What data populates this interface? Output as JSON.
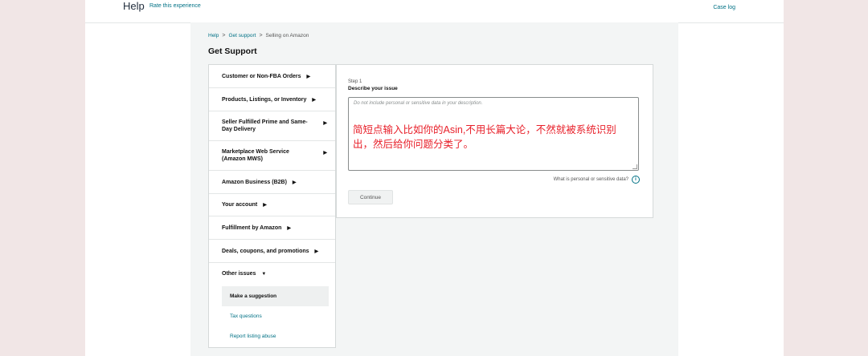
{
  "header": {
    "title": "Help",
    "rate_link": "Rate this experience",
    "case_log": "Case log"
  },
  "breadcrumb": {
    "items": [
      "Help",
      "Get support",
      "Selling on Amazon"
    ],
    "separator": ">"
  },
  "page_title": "Get Support",
  "sidebar": {
    "items": [
      {
        "label": "Customer or Non-FBA Orders"
      },
      {
        "label": "Products, Listings, or Inventory"
      },
      {
        "label": "Seller Fulfilled Prime and Same-Day Delivery"
      },
      {
        "label": "Marketplace Web Service (Amazon MWS)"
      },
      {
        "label": "Amazon Business (B2B)"
      },
      {
        "label": "Your account"
      },
      {
        "label": "Fulfillment by Amazon"
      },
      {
        "label": "Deals, coupons, and promotions"
      },
      {
        "label": "Other issues",
        "expanded": true
      }
    ],
    "subitems": [
      {
        "label": "Make a suggestion",
        "selected": true
      },
      {
        "label": "Tax questions"
      },
      {
        "label": "Report listing abuse"
      }
    ],
    "arrow_icon": "right-triangle-icon",
    "expanded_icon": "down-triangle-icon"
  },
  "form": {
    "step": "Step 1",
    "title": "Describe your issue",
    "placeholder": "Do not include personal or sensitive data in your description.",
    "value": "简短点输入比如你的Asin,不用长篇大论，不然就被系统识别出，然后给你问题分类了。",
    "sensitive_link": "What is personal or sensitive data?",
    "continue_label": "Continue"
  },
  "colors": {
    "link": "#007185",
    "annotation_text": "#e8202a",
    "outer_background": "#f1e6e6",
    "content_background": "#f3f5f5"
  }
}
